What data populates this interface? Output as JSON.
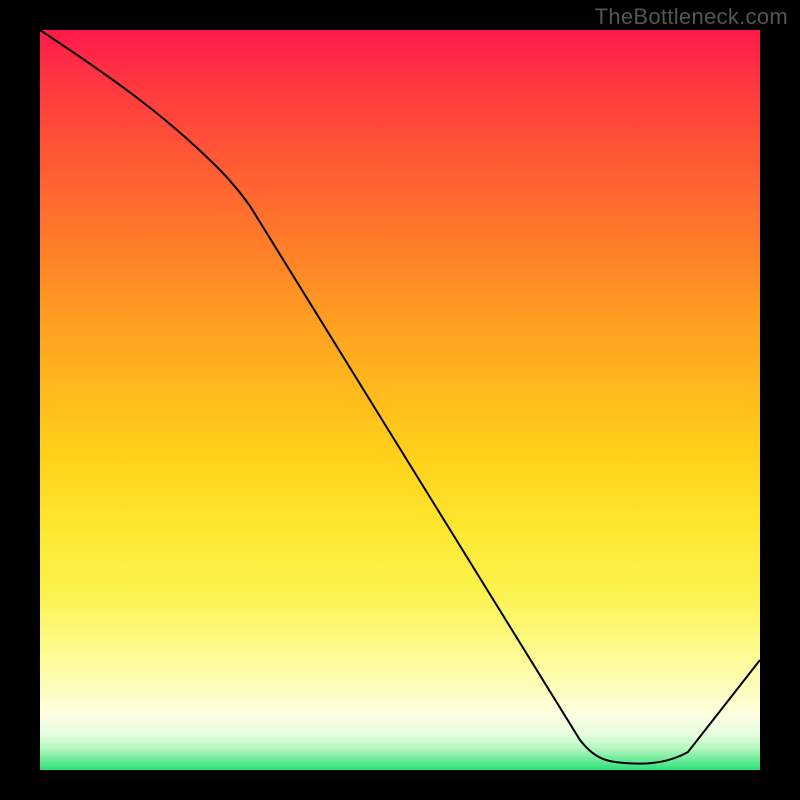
{
  "watermark": "TheBottleneck.com",
  "ideal_label": "",
  "chart_data": {
    "type": "line",
    "title": "",
    "xlabel": "",
    "ylabel": "",
    "x": [
      0.0,
      0.05,
      0.1,
      0.15,
      0.2,
      0.25,
      0.3,
      0.35,
      0.4,
      0.45,
      0.5,
      0.55,
      0.6,
      0.65,
      0.7,
      0.75,
      0.8,
      0.85,
      0.9,
      0.95,
      1.0
    ],
    "values": [
      1.0,
      0.95,
      0.9,
      0.85,
      0.79,
      0.72,
      0.64,
      0.56,
      0.48,
      0.4,
      0.32,
      0.24,
      0.17,
      0.1,
      0.04,
      0.003,
      0.005,
      0.002,
      0.03,
      0.08,
      0.15
    ],
    "xlim": [
      0,
      1
    ],
    "ylim": [
      0,
      1
    ],
    "ideal_region": {
      "x_start": 0.72,
      "x_end": 0.9
    }
  }
}
